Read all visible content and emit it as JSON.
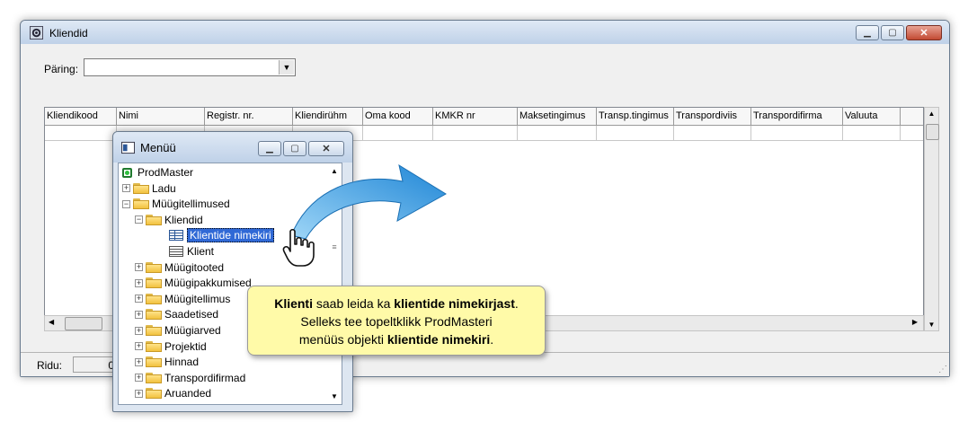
{
  "main_window": {
    "title": "Kliendid",
    "query_label": "Päring:",
    "query_value": "",
    "columns": [
      {
        "label": "Kliendikood",
        "w": 80
      },
      {
        "label": "Nimi",
        "w": 98
      },
      {
        "label": "Registr. nr.",
        "w": 98
      },
      {
        "label": "Kliendirühm",
        "w": 78
      },
      {
        "label": "Oma kood",
        "w": 78
      },
      {
        "label": "KMKR nr",
        "w": 94
      },
      {
        "label": "Maksetingimus",
        "w": 88
      },
      {
        "label": "Transp.tingimus",
        "w": 86
      },
      {
        "label": "Transpordiviis",
        "w": 86
      },
      {
        "label": "Transpordifirma",
        "w": 102
      },
      {
        "label": "Valuuta",
        "w": 64
      }
    ],
    "status_label": "Ridu:",
    "status_value": "0"
  },
  "menu_window": {
    "title": "Menüü",
    "tree": [
      {
        "label": "ProdMaster",
        "level": 0,
        "icon": "root-icon",
        "expander": ""
      },
      {
        "label": "Ladu",
        "level": 1,
        "icon": "folder-icon",
        "expander": "+"
      },
      {
        "label": "Müügitellimused",
        "level": 1,
        "icon": "folder-open-icon",
        "expander": "−"
      },
      {
        "label": "Kliendid",
        "level": 2,
        "icon": "folder-open-icon",
        "expander": "−"
      },
      {
        "label": "Klientide nimekiri",
        "level": 3,
        "icon": "grid-icon",
        "expander": "",
        "selected": true
      },
      {
        "label": "Klient",
        "level": 3,
        "icon": "form-icon",
        "expander": ""
      },
      {
        "label": "Müügitooted",
        "level": 2,
        "icon": "folder-icon",
        "expander": "+"
      },
      {
        "label": "Müügipakkumised",
        "level": 2,
        "icon": "folder-icon",
        "expander": "+"
      },
      {
        "label": "Müügitellimus",
        "level": 2,
        "icon": "folder-icon",
        "expander": "+"
      },
      {
        "label": "Saadetised",
        "level": 2,
        "icon": "folder-icon",
        "expander": "+"
      },
      {
        "label": "Müügiarved",
        "level": 2,
        "icon": "folder-icon",
        "expander": "+"
      },
      {
        "label": "Projektid",
        "level": 2,
        "icon": "folder-icon",
        "expander": "+"
      },
      {
        "label": "Hinnad",
        "level": 2,
        "icon": "folder-icon",
        "expander": "+"
      },
      {
        "label": "Transpordifirmad",
        "level": 2,
        "icon": "folder-icon",
        "expander": "+"
      },
      {
        "label": "Aruanded",
        "level": 2,
        "icon": "folder-icon",
        "expander": "+"
      }
    ]
  },
  "callout": {
    "line1_bold_a": "Klienti",
    "line1_text": " saab leida ka ",
    "line1_bold_b": "klientide nimekirjast",
    "line1_end": ".",
    "line2": "Selleks tee topeltklikk ProdMasteri",
    "line3_text": "menüüs objekti ",
    "line3_bold": "klientide nimekiri",
    "line3_end": "."
  },
  "colors": {
    "arrow": "#3ba3e6",
    "callout_bg": "#fffaa8",
    "selection": "#3069d6"
  }
}
